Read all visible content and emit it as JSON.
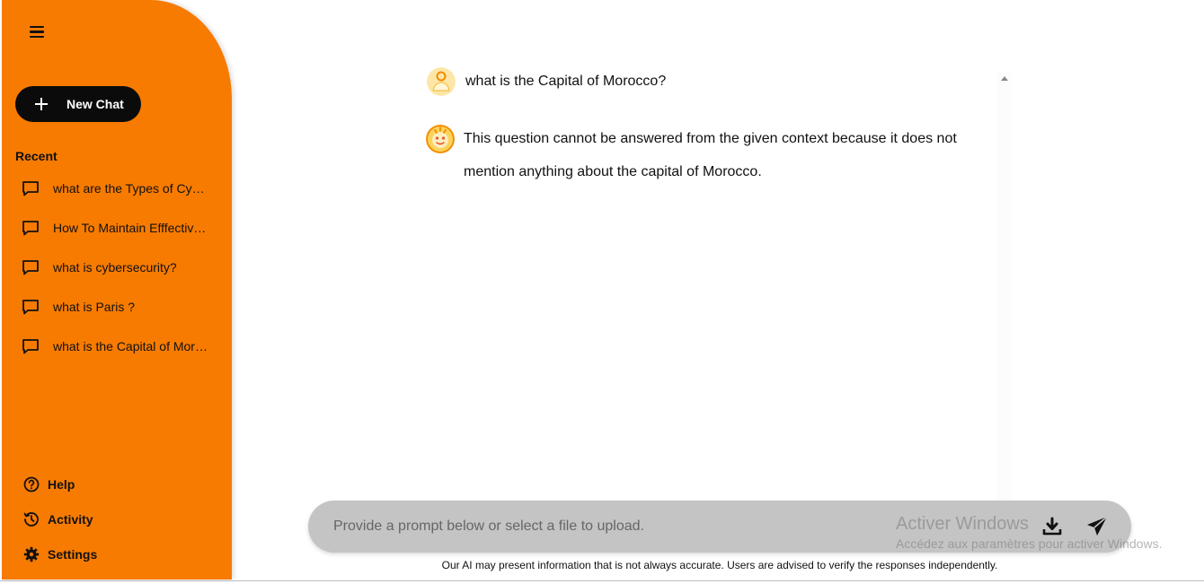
{
  "sidebar": {
    "new_chat_label": "New Chat",
    "recent_title": "Recent",
    "recent_items": [
      {
        "label": "what are the Types of Cy…"
      },
      {
        "label": "How To Maintain Efffectiv…"
      },
      {
        "label": "what is cybersecurity?"
      },
      {
        "label": "what is Paris ?"
      },
      {
        "label": "what is the Capital of Mor…"
      }
    ],
    "bottom_nav": [
      {
        "label": "Help",
        "icon": "help-circle-icon"
      },
      {
        "label": "Activity",
        "icon": "history-icon"
      },
      {
        "label": "Settings",
        "icon": "gear-icon"
      }
    ]
  },
  "chat": {
    "user_message": "what is the Capital of Morocco?",
    "bot_message": "This question cannot be answered from the given context because it does not mention anything about the capital of Morocco."
  },
  "input": {
    "placeholder": "Provide a prompt below or select a file to upload."
  },
  "watermark": {
    "title": "Activer Windows",
    "subtitle": "Accédez aux paramètres pour activer Windows."
  },
  "disclaimer": "Our AI may present information that is not always accurate. Users are advised to verify the responses independently.",
  "colors": {
    "sidebar": "#f77b00",
    "new_chat_button": "#0b0b0b",
    "input_bar": "#c4c4c4"
  }
}
